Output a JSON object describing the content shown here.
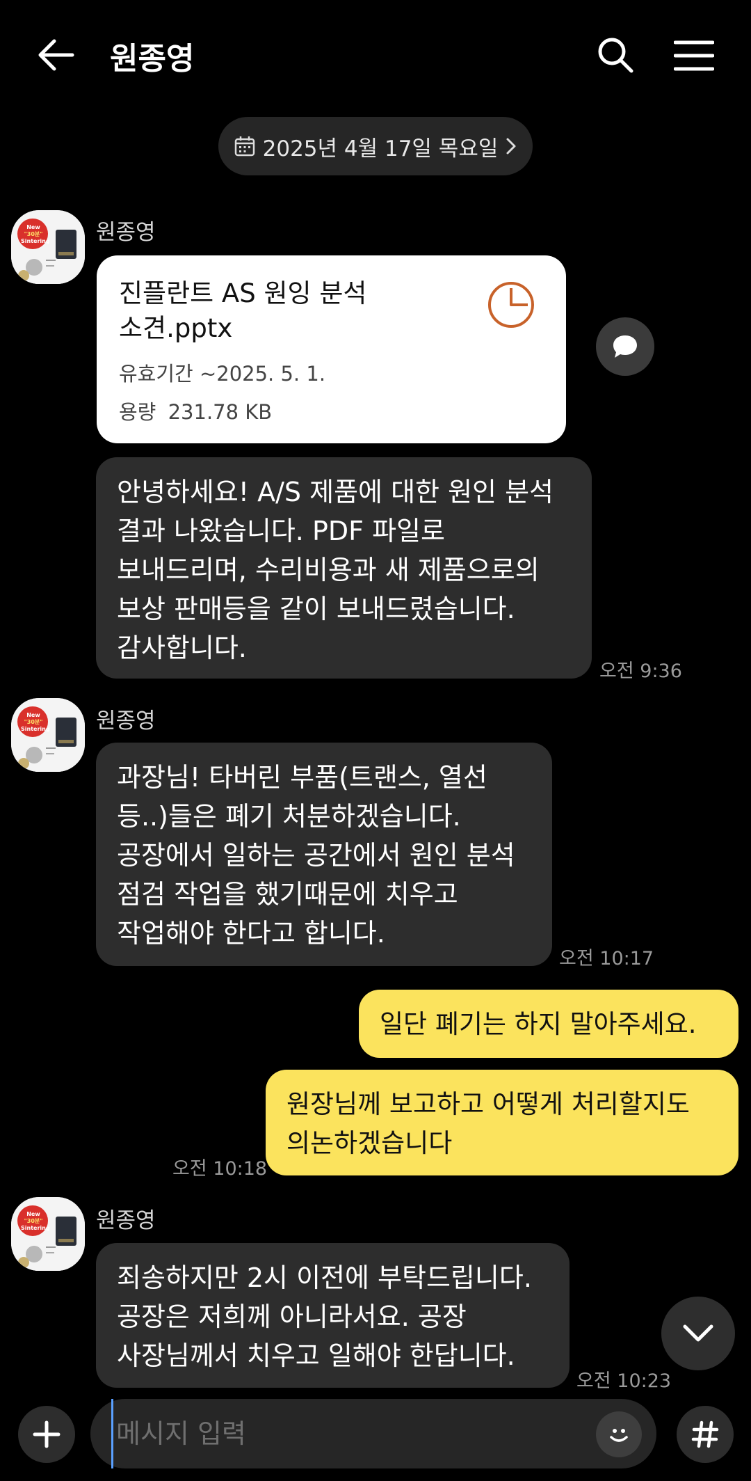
{
  "header": {
    "title": "원종영",
    "back_icon": "arrow-left-icon",
    "search_icon": "search-icon",
    "menu_icon": "hamburger-menu-icon"
  },
  "date_divider": {
    "label": "2025년 4월 17일 목요일",
    "icon": "calendar-icon",
    "chevron": "chevron-right-icon"
  },
  "messages": [
    {
      "sender": "원종영",
      "file": {
        "name": "진플란트 AS 원잉 분석\n소견.pptx",
        "validity": "유효기간 ~2025. 5. 1.",
        "size_label": "용량",
        "size": "231.78 KB",
        "icon": "pie-chart-file-icon"
      },
      "share_icon": "speech-bubble-icon",
      "text": "안녕하세요! A/S 제품에 대한 원인 분석\n결과 나왔습니다. PDF 파일로\n보내드리며, 수리비용과 새 제품으로의\n보상 판매등을 같이 보내드렸습니다.\n감사합니다.",
      "time": "오전 9:36"
    },
    {
      "sender": "원종영",
      "text": "과장님! 타버린 부품(트랜스, 열선\n등..)들은 폐기 처분하겠습니다.\n공장에서 일하는 공간에서 원인 분석\n점검 작업을 했기때문에 치우고\n작업해야 한다고 합니다.",
      "time": "오전 10:17"
    },
    {
      "outgoing": true,
      "text": "일단 폐기는 하지 말아주세요."
    },
    {
      "outgoing": true,
      "text": "원장님께 보고하고 어떻게 처리할지도\n의논하겠습니다",
      "time": "오전 10:18"
    },
    {
      "sender": "원종영",
      "text": "죄송하지만 2시 이전에 부탁드립니다.\n공장은 저희께 아니라서요. 공장\n사장님께서 치우고 일해야 한답니다.",
      "time": "오전 10:23"
    }
  ],
  "avatar": {
    "badge_line1": "New",
    "badge_line2": "\"30분\"",
    "badge_line3": "Sintering"
  },
  "composer": {
    "placeholder": "메시지 입력",
    "add_icon": "plus-icon",
    "emoji_icon": "emoji-icon",
    "hashtag_icon": "hashtag-icon"
  },
  "scroll_down_icon": "chevron-down-icon"
}
